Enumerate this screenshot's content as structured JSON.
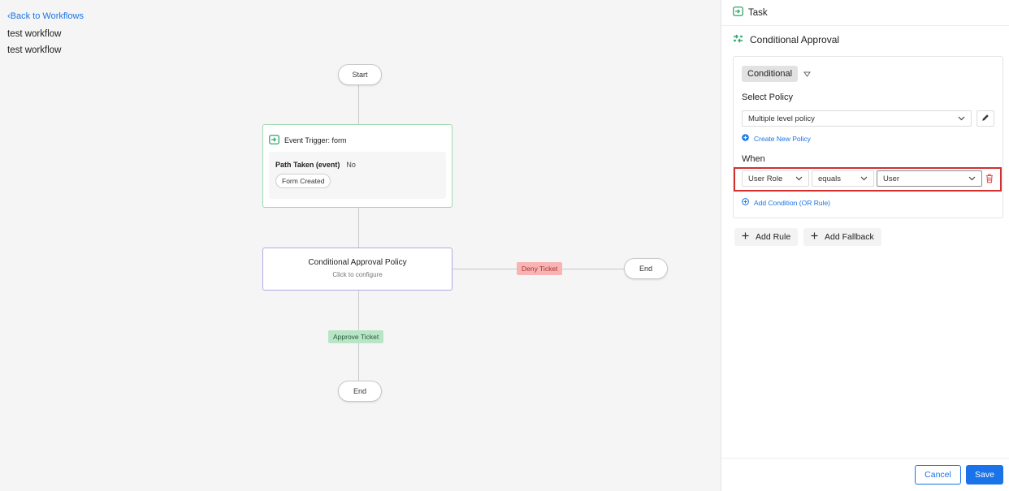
{
  "colors": {
    "accent": "#1a73e8",
    "trigger_border": "#9cd8b0",
    "policy_border": "#b7a7e3",
    "deny_bg": "#f8b4b4",
    "approve_bg": "#b9e5c7",
    "highlight": "#d32f2f",
    "icon_green": "#2fa866"
  },
  "canvas": {
    "back_link": "Back to Workflows",
    "workflow_name": "test workflow",
    "workflow_description": "test workflow",
    "start_node": "Start",
    "trigger_node": {
      "icon": "form-trigger-icon",
      "title": "Event Trigger: form",
      "path_label": "Path Taken (event)",
      "path_value": "No",
      "chip": "Form Created"
    },
    "policy_node": {
      "title": "Conditional Approval Policy",
      "subtitle": "Click to configure"
    },
    "deny_label": "Deny Ticket",
    "approve_label": "Approve Ticket",
    "end_node_right": "End",
    "end_node_bottom": "End"
  },
  "panel": {
    "header_icon": "task-icon",
    "header_title": "Task",
    "subtitle_icon": "conditional-approval-icon",
    "subtitle": "Conditional Approval",
    "rule": {
      "type_label": "Conditional",
      "select_policy_label": "Select Policy",
      "policy_value": "Multiple level policy",
      "create_policy_link": "Create New Policy",
      "when_label": "When",
      "condition": {
        "field": "User Role",
        "operator": "equals",
        "value": "User"
      },
      "add_condition_link": "Add Condition (OR Rule)"
    },
    "add_rule": "Add Rule",
    "add_fallback": "Add Fallback",
    "cancel": "Cancel",
    "save": "Save"
  }
}
